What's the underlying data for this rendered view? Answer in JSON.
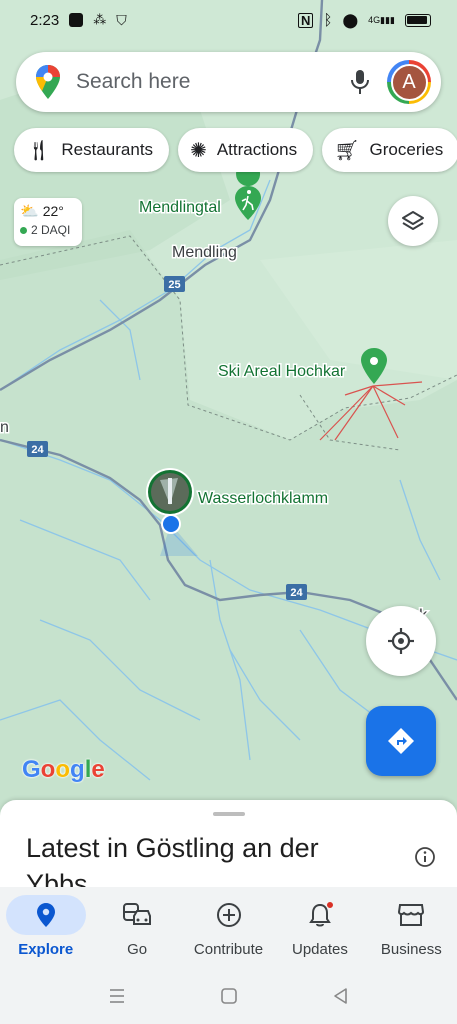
{
  "status_bar": {
    "time": "2:23",
    "network": "4G"
  },
  "search": {
    "placeholder": "Search here",
    "avatar_letter": "A"
  },
  "chips": [
    {
      "label": "Restaurants",
      "icon": "fork-knife-icon"
    },
    {
      "label": "Attractions",
      "icon": "attractions-icon"
    },
    {
      "label": "Groceries",
      "icon": "cart-icon"
    }
  ],
  "weather": {
    "temperature": "22°",
    "aqi": "2 DAQI"
  },
  "map": {
    "places": {
      "mendlingtal": "Mendlingtal",
      "mendling": "Mendling",
      "ski": "Ski Areal Hochkar",
      "wasserlochklamm": "Wasserlochklamm",
      "edge_left": "n",
      "edge_right": "...werk"
    },
    "road_shields": {
      "r25": "25",
      "r24a": "24",
      "r24b": "24"
    },
    "colors": {
      "land": "#cfe8d5",
      "road": "#7a8fa6",
      "river": "#8ec6e8",
      "park": "#137333",
      "pin": "#34a853",
      "location": "#1a73e8"
    }
  },
  "google_logo": [
    "G",
    "o",
    "o",
    "g",
    "l",
    "e"
  ],
  "sheet": {
    "title": "Latest in Göstling an der Ybbs"
  },
  "bottom_nav": [
    {
      "label": "Explore",
      "active": true
    },
    {
      "label": "Go",
      "active": false
    },
    {
      "label": "Contribute",
      "active": false
    },
    {
      "label": "Updates",
      "active": false
    },
    {
      "label": "Business",
      "active": false
    }
  ]
}
